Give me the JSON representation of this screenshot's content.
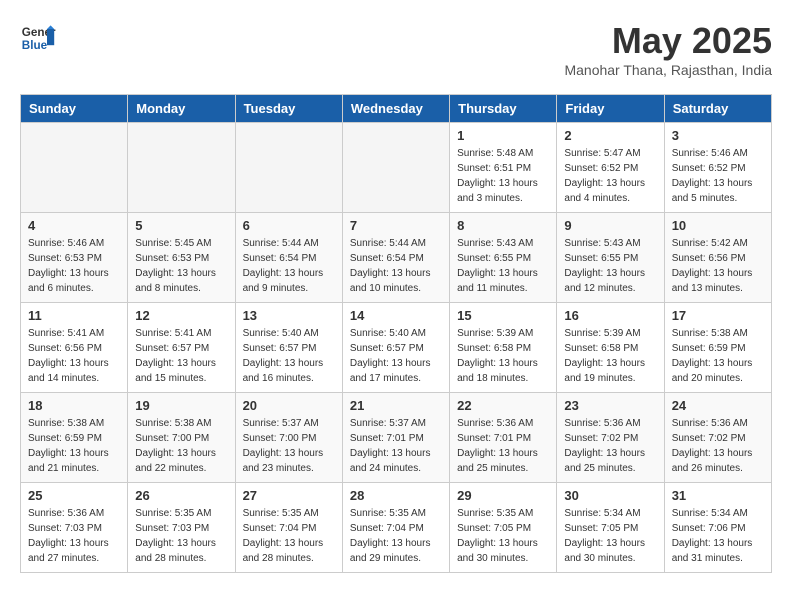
{
  "header": {
    "logo_line1": "General",
    "logo_line2": "Blue",
    "month_year": "May 2025",
    "location": "Manohar Thana, Rajasthan, India"
  },
  "weekdays": [
    "Sunday",
    "Monday",
    "Tuesday",
    "Wednesday",
    "Thursday",
    "Friday",
    "Saturday"
  ],
  "weeks": [
    [
      {
        "day": "",
        "empty": true
      },
      {
        "day": "",
        "empty": true
      },
      {
        "day": "",
        "empty": true
      },
      {
        "day": "",
        "empty": true
      },
      {
        "day": "1",
        "sunrise": "5:48 AM",
        "sunset": "6:51 PM",
        "daylight": "13 hours and 3 minutes."
      },
      {
        "day": "2",
        "sunrise": "5:47 AM",
        "sunset": "6:52 PM",
        "daylight": "13 hours and 4 minutes."
      },
      {
        "day": "3",
        "sunrise": "5:46 AM",
        "sunset": "6:52 PM",
        "daylight": "13 hours and 5 minutes."
      }
    ],
    [
      {
        "day": "4",
        "sunrise": "5:46 AM",
        "sunset": "6:53 PM",
        "daylight": "13 hours and 6 minutes."
      },
      {
        "day": "5",
        "sunrise": "5:45 AM",
        "sunset": "6:53 PM",
        "daylight": "13 hours and 8 minutes."
      },
      {
        "day": "6",
        "sunrise": "5:44 AM",
        "sunset": "6:54 PM",
        "daylight": "13 hours and 9 minutes."
      },
      {
        "day": "7",
        "sunrise": "5:44 AM",
        "sunset": "6:54 PM",
        "daylight": "13 hours and 10 minutes."
      },
      {
        "day": "8",
        "sunrise": "5:43 AM",
        "sunset": "6:55 PM",
        "daylight": "13 hours and 11 minutes."
      },
      {
        "day": "9",
        "sunrise": "5:43 AM",
        "sunset": "6:55 PM",
        "daylight": "13 hours and 12 minutes."
      },
      {
        "day": "10",
        "sunrise": "5:42 AM",
        "sunset": "6:56 PM",
        "daylight": "13 hours and 13 minutes."
      }
    ],
    [
      {
        "day": "11",
        "sunrise": "5:41 AM",
        "sunset": "6:56 PM",
        "daylight": "13 hours and 14 minutes."
      },
      {
        "day": "12",
        "sunrise": "5:41 AM",
        "sunset": "6:57 PM",
        "daylight": "13 hours and 15 minutes."
      },
      {
        "day": "13",
        "sunrise": "5:40 AM",
        "sunset": "6:57 PM",
        "daylight": "13 hours and 16 minutes."
      },
      {
        "day": "14",
        "sunrise": "5:40 AM",
        "sunset": "6:57 PM",
        "daylight": "13 hours and 17 minutes."
      },
      {
        "day": "15",
        "sunrise": "5:39 AM",
        "sunset": "6:58 PM",
        "daylight": "13 hours and 18 minutes."
      },
      {
        "day": "16",
        "sunrise": "5:39 AM",
        "sunset": "6:58 PM",
        "daylight": "13 hours and 19 minutes."
      },
      {
        "day": "17",
        "sunrise": "5:38 AM",
        "sunset": "6:59 PM",
        "daylight": "13 hours and 20 minutes."
      }
    ],
    [
      {
        "day": "18",
        "sunrise": "5:38 AM",
        "sunset": "6:59 PM",
        "daylight": "13 hours and 21 minutes."
      },
      {
        "day": "19",
        "sunrise": "5:38 AM",
        "sunset": "7:00 PM",
        "daylight": "13 hours and 22 minutes."
      },
      {
        "day": "20",
        "sunrise": "5:37 AM",
        "sunset": "7:00 PM",
        "daylight": "13 hours and 23 minutes."
      },
      {
        "day": "21",
        "sunrise": "5:37 AM",
        "sunset": "7:01 PM",
        "daylight": "13 hours and 24 minutes."
      },
      {
        "day": "22",
        "sunrise": "5:36 AM",
        "sunset": "7:01 PM",
        "daylight": "13 hours and 25 minutes."
      },
      {
        "day": "23",
        "sunrise": "5:36 AM",
        "sunset": "7:02 PM",
        "daylight": "13 hours and 25 minutes."
      },
      {
        "day": "24",
        "sunrise": "5:36 AM",
        "sunset": "7:02 PM",
        "daylight": "13 hours and 26 minutes."
      }
    ],
    [
      {
        "day": "25",
        "sunrise": "5:36 AM",
        "sunset": "7:03 PM",
        "daylight": "13 hours and 27 minutes."
      },
      {
        "day": "26",
        "sunrise": "5:35 AM",
        "sunset": "7:03 PM",
        "daylight": "13 hours and 28 minutes."
      },
      {
        "day": "27",
        "sunrise": "5:35 AM",
        "sunset": "7:04 PM",
        "daylight": "13 hours and 28 minutes."
      },
      {
        "day": "28",
        "sunrise": "5:35 AM",
        "sunset": "7:04 PM",
        "daylight": "13 hours and 29 minutes."
      },
      {
        "day": "29",
        "sunrise": "5:35 AM",
        "sunset": "7:05 PM",
        "daylight": "13 hours and 30 minutes."
      },
      {
        "day": "30",
        "sunrise": "5:34 AM",
        "sunset": "7:05 PM",
        "daylight": "13 hours and 30 minutes."
      },
      {
        "day": "31",
        "sunrise": "5:34 AM",
        "sunset": "7:06 PM",
        "daylight": "13 hours and 31 minutes."
      }
    ]
  ]
}
